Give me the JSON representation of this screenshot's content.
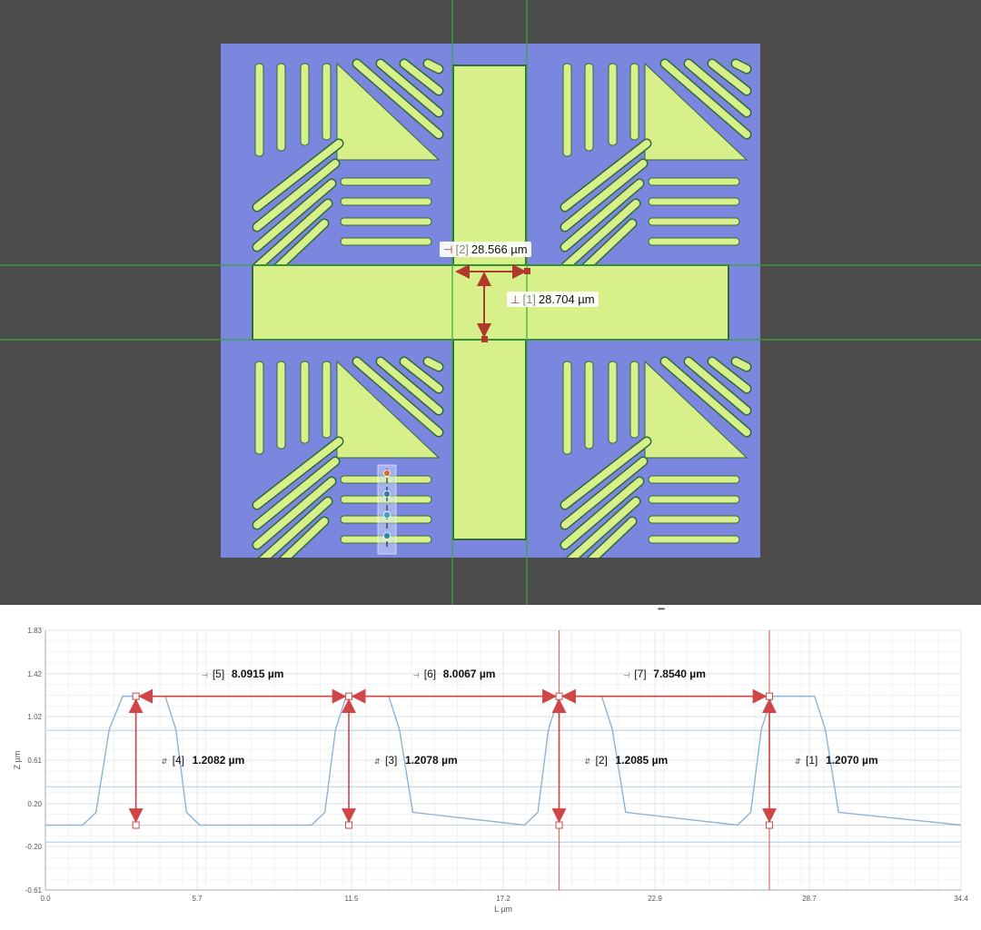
{
  "viewer": {
    "measurements": [
      {
        "index": "[2]",
        "value": "28.566 µm",
        "icon": "horizontal-distance-icon",
        "color": "#b0392b"
      },
      {
        "index": "[1]",
        "value": "28.704 µm",
        "icon": "vertical-distance-icon",
        "color": "#b0392b"
      }
    ],
    "colors": {
      "background": "#4b4b4b",
      "substrate": "#7b86de",
      "feature": "#d7f08a",
      "guide": "#3aa83a",
      "marker": "#b0392b"
    }
  },
  "splitter": {
    "grip": "••••"
  },
  "chart_data": {
    "type": "line",
    "xlabel": "L µm",
    "ylabel": "Z µm",
    "xlim": [
      0.0,
      34.4
    ],
    "ylim": [
      -0.61,
      1.83
    ],
    "x_ticks": [
      "0.0",
      "5.7",
      "11.5",
      "17.2",
      "22.9",
      "28.7",
      "34.4"
    ],
    "y_ticks": [
      "1.83",
      "1.42",
      "1.02",
      "0.61",
      "0.20",
      "-0.20",
      "-0.61"
    ],
    "series": [
      {
        "x": [
          0.0,
          1.4,
          1.9,
          2.4,
          2.9,
          3.3,
          3.6,
          4.0,
          4.5,
          4.9,
          5.3,
          5.8,
          10.0,
          10.5,
          10.9,
          11.3,
          11.7,
          12.0,
          12.4,
          12.9,
          13.3,
          13.8,
          18.0,
          18.5,
          18.9,
          19.3,
          19.7,
          20.0,
          20.4,
          20.9,
          21.3,
          21.8,
          26.0,
          26.5,
          26.9,
          27.3,
          27.7,
          28.0,
          28.4,
          28.9,
          29.3,
          29.8,
          34.4
        ],
        "y": [
          0.0,
          0.0,
          0.12,
          0.9,
          1.21,
          1.21,
          1.21,
          1.21,
          1.21,
          0.9,
          0.12,
          0.0,
          0.0,
          0.12,
          0.9,
          1.21,
          1.21,
          1.21,
          1.21,
          1.21,
          0.9,
          0.12,
          0.0,
          0.12,
          0.9,
          1.21,
          1.21,
          1.21,
          1.21,
          1.21,
          0.9,
          0.12,
          0.0,
          0.12,
          0.9,
          1.21,
          1.21,
          1.21,
          1.21,
          1.21,
          0.9,
          0.12,
          0.0
        ]
      }
    ],
    "horizontal_dims": [
      {
        "index": "[5]",
        "value": "8.0915 µm",
        "x1": 3.4,
        "x2": 11.4,
        "color": "#d08a2a"
      },
      {
        "index": "[6]",
        "value": "8.0067 µm",
        "x1": 11.4,
        "x2": 19.3,
        "color": "#8c5bb5"
      },
      {
        "index": "[7]",
        "value": "7.8540 µm",
        "x1": 19.3,
        "x2": 27.2,
        "color": "#2a9fc0"
      }
    ],
    "vertical_dims": [
      {
        "index": "[4]",
        "value": "1.2082 µm",
        "x": 3.4,
        "color": "#2a9fc0"
      },
      {
        "index": "[3]",
        "value": "1.2078 µm",
        "x": 11.4,
        "color": "#5b6bb5"
      },
      {
        "index": "[2]",
        "value": "1.2085 µm",
        "x": 19.3,
        "color": "#b0392b"
      },
      {
        "index": "[1]",
        "value": "1.2070 µm",
        "x": 27.2,
        "color": "#d0a02a"
      }
    ],
    "dim_top": 1.21,
    "dim_bottom": 0.0,
    "cursors": [
      19.3,
      27.2
    ],
    "reference_lines": [
      0.89,
      0.36,
      -0.16
    ]
  }
}
